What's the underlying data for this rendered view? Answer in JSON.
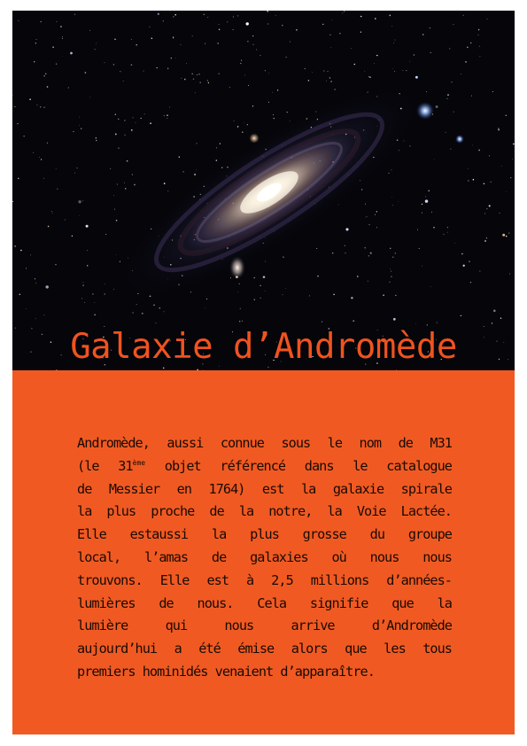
{
  "document": {
    "title": "Galaxie d’Andromède",
    "photo": {
      "subject": "andromeda-galaxy-image"
    },
    "colors": {
      "accent": "#f05a22",
      "title": "#f0531f",
      "text": "#1a0a04",
      "sky": "#05050a"
    },
    "body": {
      "line1": "Andromède, aussi connue sous le nom de M31",
      "line2_a": "(le 31",
      "line2_sup": "ème",
      "line2_b": " objet référencé dans le catalogue",
      "line3": "de Messier en 1764) est la galaxie spirale",
      "line4": "la plus proche de la notre, la Voie Lactée.",
      "line5": "Elle estaussi la plus grosse du groupe",
      "line6": "local, l’amas de galaxies où nous nous",
      "line7": "trouvons. Elle est à 2,5 millions d’années-",
      "line8": "lumières de nous. Cela signifie que la",
      "line9": "lumière qui nous arrive d’Andromède",
      "line10": "aujourd’hui a été émise alors que les tous",
      "line11": "premiers hominidés venaient d’apparaître."
    }
  }
}
